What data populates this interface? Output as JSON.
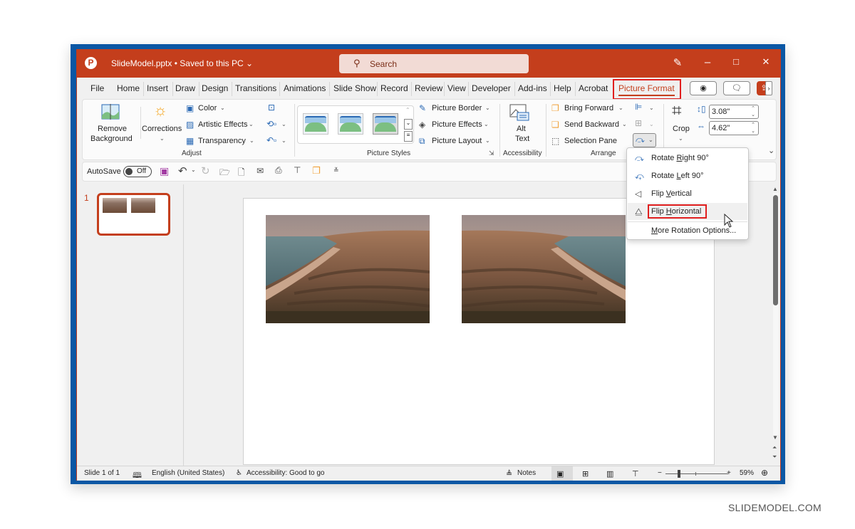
{
  "window": {
    "app_icon": "powerpoint-icon",
    "document_title": "SlideModel.pptx",
    "save_status": "Saved to this PC",
    "search_placeholder": "Search",
    "controls": {
      "minimize": "–",
      "maximize": "□",
      "close": "✕"
    }
  },
  "tabs": [
    {
      "label": "File"
    },
    {
      "label": "Home"
    },
    {
      "label": "Insert"
    },
    {
      "label": "Draw"
    },
    {
      "label": "Design"
    },
    {
      "label": "Transitions"
    },
    {
      "label": "Animations"
    },
    {
      "label": "Slide Show"
    },
    {
      "label": "Record"
    },
    {
      "label": "Review"
    },
    {
      "label": "View"
    },
    {
      "label": "Developer"
    },
    {
      "label": "Add-ins"
    },
    {
      "label": "Help"
    },
    {
      "label": "Acrobat"
    },
    {
      "label": "Picture Format",
      "active": true
    }
  ],
  "ribbon": {
    "adjust": {
      "remove_background": [
        "Remove",
        "Background"
      ],
      "corrections": "Corrections",
      "color": "Color",
      "artistic_effects": "Artistic Effects",
      "transparency": "Transparency",
      "label": "Adjust"
    },
    "picture_styles": {
      "picture_border": "Picture Border",
      "picture_effects": "Picture Effects",
      "picture_layout": "Picture Layout",
      "label": "Picture Styles"
    },
    "accessibility": {
      "alt_text": [
        "Alt",
        "Text"
      ],
      "label": "Accessibility"
    },
    "arrange": {
      "bring_forward": "Bring Forward",
      "send_backward": "Send Backward",
      "selection_pane": "Selection Pane",
      "label": "Arrange"
    },
    "size": {
      "crop": "Crop",
      "height": "3.08\"",
      "width": "4.62\""
    }
  },
  "quick_access": {
    "autosave_label": "AutoSave",
    "autosave_state": "Off"
  },
  "slides_pane": {
    "slide_number": "1"
  },
  "rotate_menu": {
    "items": [
      {
        "pre": "Rotate ",
        "key": "R",
        "post": "ight 90°",
        "icon": "rotate-right-icon"
      },
      {
        "pre": "Rotate ",
        "key": "L",
        "post": "eft 90°",
        "icon": "rotate-left-icon"
      },
      {
        "pre": "Flip ",
        "key": "V",
        "post": "ertical",
        "icon": "flip-vertical-icon"
      },
      {
        "pre": "Flip ",
        "key": "H",
        "post": "orizontal",
        "icon": "flip-horizontal-icon",
        "highlighted": true
      },
      {
        "pre": "",
        "key": "M",
        "post": "ore Rotation Options...",
        "icon": ""
      }
    ]
  },
  "status_bar": {
    "slide_info": "Slide 1 of 1",
    "language": "English (United States)",
    "accessibility": "Accessibility: Good to go",
    "notes": "Notes",
    "zoom_level": "59%",
    "zoom_minus": "−",
    "zoom_plus": "+"
  },
  "watermark": "SLIDEMODEL.COM",
  "colors": {
    "accent": "#c43e1c",
    "highlight_box": "#e01e1e",
    "frame": "#0b57a4"
  }
}
